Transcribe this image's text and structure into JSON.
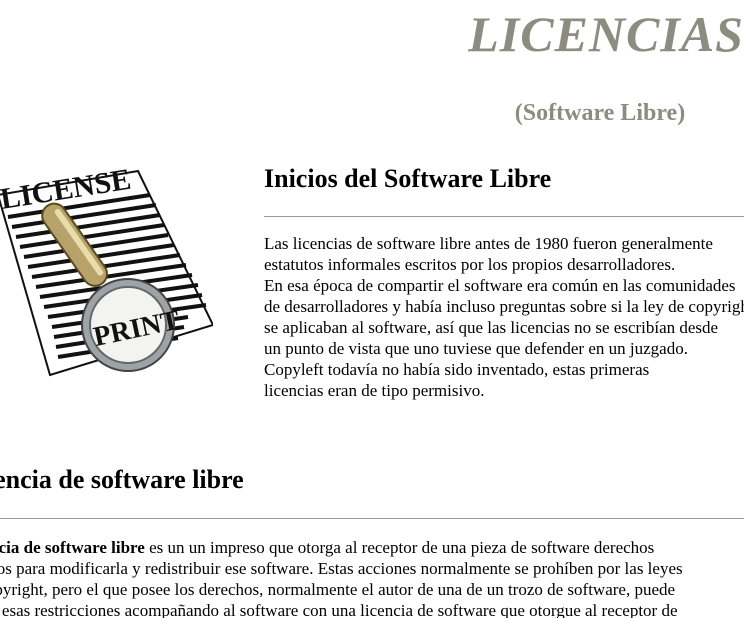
{
  "header": {
    "title": "LICENCIAS",
    "subtitle": "(Software Libre)"
  },
  "image": {
    "top_text": "LICENSE",
    "lens_text": "PRINT"
  },
  "section1": {
    "heading": "Inicios del Software Libre",
    "lines": [
      "Las licencias de software libre antes de 1980 fueron generalmente",
      "estatutos informales escritos por los propios desarrolladores.",
      "En esa época de compartir el software era común en las comunidades",
      "de desarrolladores y había incluso preguntas sobre si la ley de copyright",
      "se aplicaban al software, así que las licencias no se escribían desde",
      "un punto de vista que uno tuviese que defender en un juzgado.",
      "Copyleft todavía no había sido inventado, estas primeras",
      "licencias eran de tipo permisivo."
    ]
  },
  "section2": {
    "heading": "Licencia de software libre",
    "line1_bold": "Licencia de software libre",
    "line1_rest": " es un un impreso que otorga al receptor de una pieza de software derechos",
    "line2": "amplios para modificarla y redistribuir ese software. Estas acciones normalmente se prohíben por las leyes",
    "line3": "de copyright, pero el que posee los derechos, normalmente el autor de una de un trozo de software, puede",
    "line4": "quitar esas restricciones acompañando al software con una licencia de software que otorgue al receptor de"
  }
}
